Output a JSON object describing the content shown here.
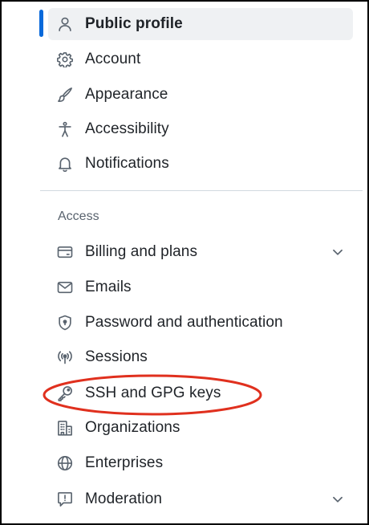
{
  "nav": {
    "top_items": [
      {
        "label": "Public profile",
        "icon": "person-icon"
      },
      {
        "label": "Account",
        "icon": "gear-icon"
      },
      {
        "label": "Appearance",
        "icon": "paintbrush-icon"
      },
      {
        "label": "Accessibility",
        "icon": "accessibility-icon"
      },
      {
        "label": "Notifications",
        "icon": "bell-icon"
      }
    ],
    "section_heading": "Access",
    "access_items": [
      {
        "label": "Billing and plans",
        "icon": "credit-card-icon",
        "expandable": true
      },
      {
        "label": "Emails",
        "icon": "mail-icon"
      },
      {
        "label": "Password and authentication",
        "icon": "shield-lock-icon"
      },
      {
        "label": "Sessions",
        "icon": "broadcast-icon"
      },
      {
        "label": "SSH and GPG keys",
        "icon": "key-icon"
      },
      {
        "label": "Organizations",
        "icon": "organization-icon"
      },
      {
        "label": "Enterprises",
        "icon": "globe-icon"
      },
      {
        "label": "Moderation",
        "icon": "report-icon",
        "expandable": true
      }
    ],
    "selected": "Public profile"
  },
  "colors": {
    "accent": "#0969da",
    "highlight_annotation": "#e0301e",
    "selected_bg": "#eff1f3",
    "icon": "#59636e"
  }
}
